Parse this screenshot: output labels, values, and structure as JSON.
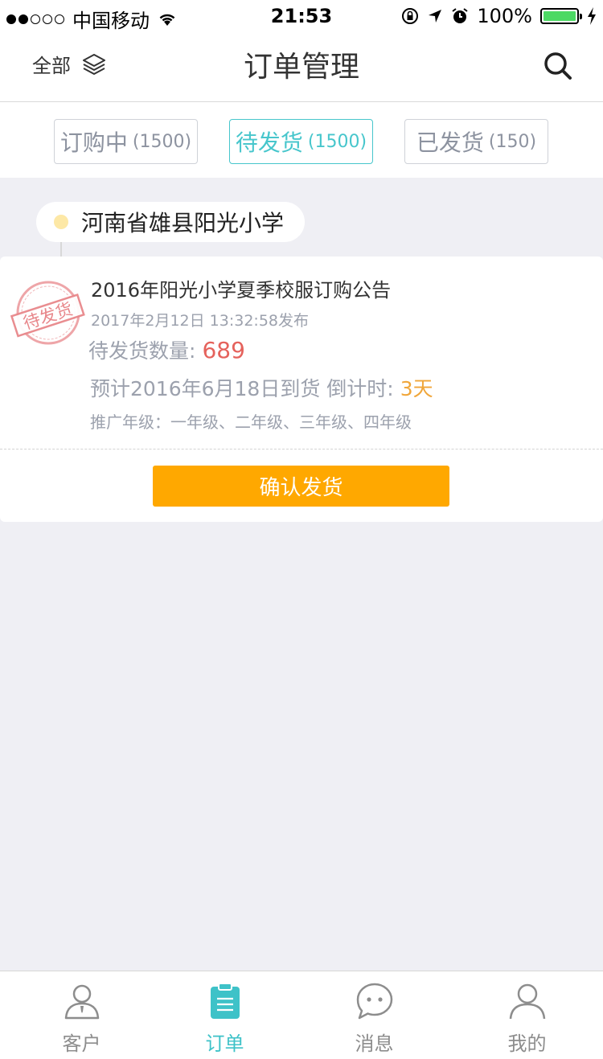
{
  "status_bar": {
    "carrier": "中国移动",
    "time": "21:53",
    "battery": "100%",
    "battery_level": 1.0,
    "signal_bars_filled": 2,
    "signal_bars_total": 5
  },
  "nav": {
    "filter_label": "全部",
    "title": "订单管理"
  },
  "tabs": [
    {
      "label": "订购中",
      "count": "(1500)",
      "active": false
    },
    {
      "label": "待发货",
      "count": "(1500)",
      "active": true
    },
    {
      "label": "已发货",
      "count": "(150)",
      "active": false
    }
  ],
  "school": {
    "name": "河南省雄县阳光小学"
  },
  "order": {
    "stamp_text": "待发货",
    "title": "2016年阳光小学夏季校服订购公告",
    "published": "2017年2月12日 13:32:58发布",
    "qty_label": "待发货数量:",
    "qty_value": "689",
    "eta_text": "预计2016年6月18日到货 倒计时:",
    "eta_days": "3天",
    "grades": "推广年级：一年级、二年级、三年级、四年级",
    "confirm_label": "确认发货"
  },
  "tab_bar": [
    {
      "label": "客户",
      "icon": "customer-icon",
      "active": false
    },
    {
      "label": "订单",
      "icon": "order-icon",
      "active": true
    },
    {
      "label": "消息",
      "icon": "message-icon",
      "active": false
    },
    {
      "label": "我的",
      "icon": "profile-icon",
      "active": false
    }
  ],
  "colors": {
    "accent": "#47c6cc",
    "confirm": "#ffa800",
    "qty": "#e5625c",
    "countdown": "#f0a63a",
    "stamp": "#e8878b"
  }
}
